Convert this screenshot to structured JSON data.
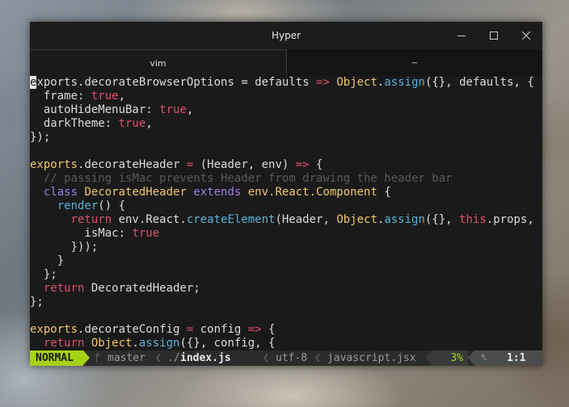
{
  "window": {
    "title": "Hyper"
  },
  "tabs": [
    {
      "label": "vim",
      "active": true
    },
    {
      "label": "~",
      "active": false
    }
  ],
  "editor": {
    "lines": [
      [
        {
          "t": "e",
          "c": "cursor"
        },
        {
          "t": "xports",
          "c": ""
        },
        {
          "t": ".",
          "c": ""
        },
        {
          "t": "decorateBrowserOptions",
          "c": ""
        },
        {
          "t": " = ",
          "c": ""
        },
        {
          "t": "defaults",
          "c": ""
        },
        {
          "t": " => ",
          "c": "c-op"
        },
        {
          "t": "Object",
          "c": "c-obj"
        },
        {
          "t": ".",
          "c": ""
        },
        {
          "t": "assign",
          "c": "c-fn"
        },
        {
          "t": "({}, defaults, {",
          "c": ""
        }
      ],
      [
        {
          "t": "  frame: ",
          "c": ""
        },
        {
          "t": "true",
          "c": "c-kw"
        },
        {
          "t": ",",
          "c": ""
        }
      ],
      [
        {
          "t": "  autoHideMenuBar: ",
          "c": ""
        },
        {
          "t": "true",
          "c": "c-kw"
        },
        {
          "t": ",",
          "c": ""
        }
      ],
      [
        {
          "t": "  darkTheme: ",
          "c": ""
        },
        {
          "t": "true",
          "c": "c-kw"
        },
        {
          "t": ",",
          "c": ""
        }
      ],
      [
        {
          "t": "});",
          "c": ""
        }
      ],
      [],
      [
        {
          "t": "exports",
          "c": "c-obj"
        },
        {
          "t": ".decorateHeader ",
          "c": ""
        },
        {
          "t": "=",
          "c": "c-op"
        },
        {
          "t": " (Header, env) ",
          "c": ""
        },
        {
          "t": "=>",
          "c": "c-op"
        },
        {
          "t": " {",
          "c": ""
        }
      ],
      [
        {
          "t": "  // passing isMac prevents Header from drawing the header bar",
          "c": "c-cmt"
        }
      ],
      [
        {
          "t": "  class ",
          "c": "c-cls"
        },
        {
          "t": "DecoratedHeader ",
          "c": "c-obj"
        },
        {
          "t": "extends ",
          "c": "c-cls"
        },
        {
          "t": "env.React.Component",
          "c": "c-obj"
        },
        {
          "t": " {",
          "c": ""
        }
      ],
      [
        {
          "t": "    render",
          "c": "c-fn"
        },
        {
          "t": "() {",
          "c": ""
        }
      ],
      [
        {
          "t": "      return ",
          "c": "c-kw"
        },
        {
          "t": "env.React.",
          "c": ""
        },
        {
          "t": "createElement",
          "c": "c-fn"
        },
        {
          "t": "(Header, ",
          "c": ""
        },
        {
          "t": "Object",
          "c": "c-obj"
        },
        {
          "t": ".",
          "c": ""
        },
        {
          "t": "assign",
          "c": "c-fn"
        },
        {
          "t": "({}, ",
          "c": ""
        },
        {
          "t": "this",
          "c": "c-kw"
        },
        {
          "t": ".props, {",
          "c": ""
        }
      ],
      [
        {
          "t": "        isMac: ",
          "c": ""
        },
        {
          "t": "true",
          "c": "c-kw"
        }
      ],
      [
        {
          "t": "      }));",
          "c": ""
        }
      ],
      [
        {
          "t": "    }",
          "c": ""
        }
      ],
      [
        {
          "t": "  };",
          "c": ""
        }
      ],
      [
        {
          "t": "  return ",
          "c": "c-kw"
        },
        {
          "t": "DecoratedHeader;",
          "c": ""
        }
      ],
      [
        {
          "t": "};",
          "c": ""
        }
      ],
      [],
      [
        {
          "t": "exports",
          "c": "c-obj"
        },
        {
          "t": ".decorateConfig ",
          "c": ""
        },
        {
          "t": "=",
          "c": "c-op"
        },
        {
          "t": " config ",
          "c": ""
        },
        {
          "t": "=>",
          "c": "c-op"
        },
        {
          "t": " {",
          "c": ""
        }
      ],
      [
        {
          "t": "  return ",
          "c": "c-kw"
        },
        {
          "t": "Object",
          "c": "c-obj"
        },
        {
          "t": ".",
          "c": ""
        },
        {
          "t": "assign",
          "c": "c-fn"
        },
        {
          "t": "({}, config, {",
          "c": ""
        }
      ]
    ]
  },
  "statusline": {
    "mode": "NORMAL",
    "branch_icon": "ᚠ",
    "branch": "master",
    "path_prefix": "./",
    "filename": "index.js",
    "encoding": "utf-8",
    "filetype": "javascript.jsx",
    "percent": "3%",
    "line_icon": "␤",
    "position": "1:1"
  }
}
